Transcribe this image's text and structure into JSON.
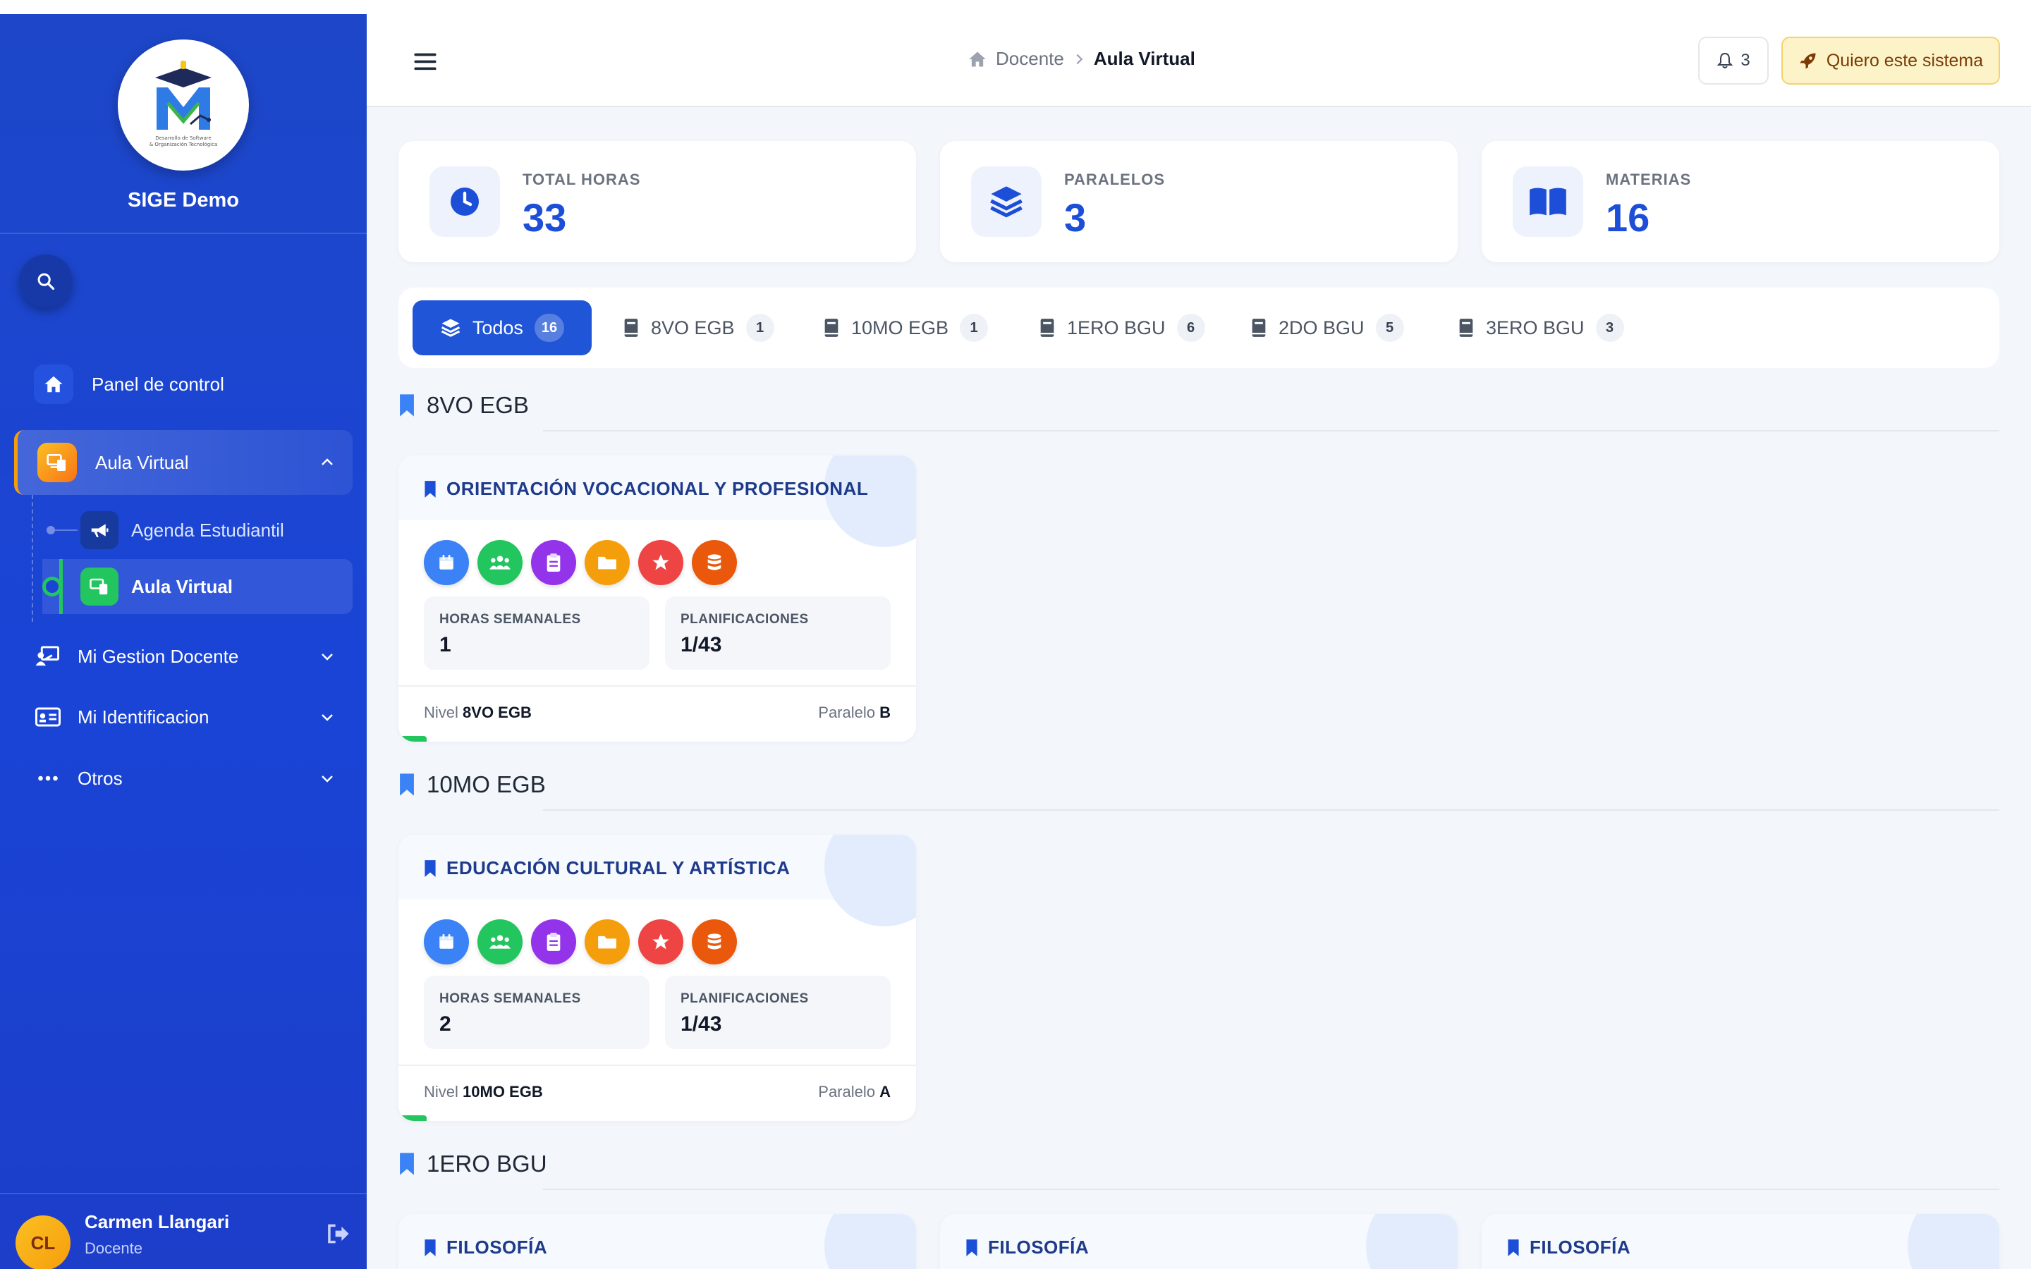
{
  "brand": {
    "name": "SIGE Demo",
    "logo_caption": "Desarrollo de Software & Organización Tecnológica"
  },
  "sidebar": {
    "home": "Panel de control",
    "aula_group": "Aula Virtual",
    "sub": {
      "agenda": "Agenda Estudiantil",
      "aula": "Aula Virtual"
    },
    "gestion": "Mi Gestion Docente",
    "ident": "Mi Identificacion",
    "otros": "Otros"
  },
  "user": {
    "initials": "CL",
    "name": "Carmen Llangari",
    "role": "Docente"
  },
  "header": {
    "crumbs": [
      "Docente",
      "Aula Virtual"
    ],
    "notifications": "3",
    "cta": "Quiero este sistema"
  },
  "stats": [
    {
      "label": "TOTAL HORAS",
      "value": "33"
    },
    {
      "label": "PARALELOS",
      "value": "3"
    },
    {
      "label": "MATERIAS",
      "value": "16"
    }
  ],
  "tabs": [
    {
      "label": "Todos",
      "count": "16",
      "active": true
    },
    {
      "label": "8VO EGB",
      "count": "1"
    },
    {
      "label": "10MO EGB",
      "count": "1"
    },
    {
      "label": "1ERO BGU",
      "count": "6"
    },
    {
      "label": "2DO BGU",
      "count": "5"
    },
    {
      "label": "3ERO BGU",
      "count": "3"
    }
  ],
  "sections": [
    {
      "title": "8VO EGB",
      "cards": [
        {
          "title": "ORIENTACIÓN VOCACIONAL Y PROFESIONAL",
          "hours_label": "HORAS SEMANALES",
          "hours": "1",
          "plan_label": "PLANIFICACIONES",
          "plan": "1/43",
          "nivel_label": "Nivel",
          "nivel": "8VO EGB",
          "paralelo_label": "Paralelo",
          "paralelo": "B"
        }
      ]
    },
    {
      "title": "10MO EGB",
      "cards": [
        {
          "title": "EDUCACIÓN CULTURAL Y ARTÍSTICA",
          "hours_label": "HORAS SEMANALES",
          "hours": "2",
          "plan_label": "PLANIFICACIONES",
          "plan": "1/43",
          "nivel_label": "Nivel",
          "nivel": "10MO EGB",
          "paralelo_label": "Paralelo",
          "paralelo": "A"
        }
      ]
    },
    {
      "title": "1ERO BGU",
      "cards": [
        {
          "title": "FILOSOFÍA"
        },
        {
          "title": "FILOSOFÍA"
        },
        {
          "title": "FILOSOFÍA"
        }
      ]
    }
  ],
  "card_actions": [
    {
      "icon": "calendar-icon",
      "color": "#3b82f6"
    },
    {
      "icon": "users-icon",
      "color": "#22c55e"
    },
    {
      "icon": "clipboard-icon",
      "color": "#9333ea"
    },
    {
      "icon": "folder-icon",
      "color": "#f59e0b"
    },
    {
      "icon": "star-icon",
      "color": "#ef4444"
    },
    {
      "icon": "database-icon",
      "color": "#ea580c"
    }
  ]
}
